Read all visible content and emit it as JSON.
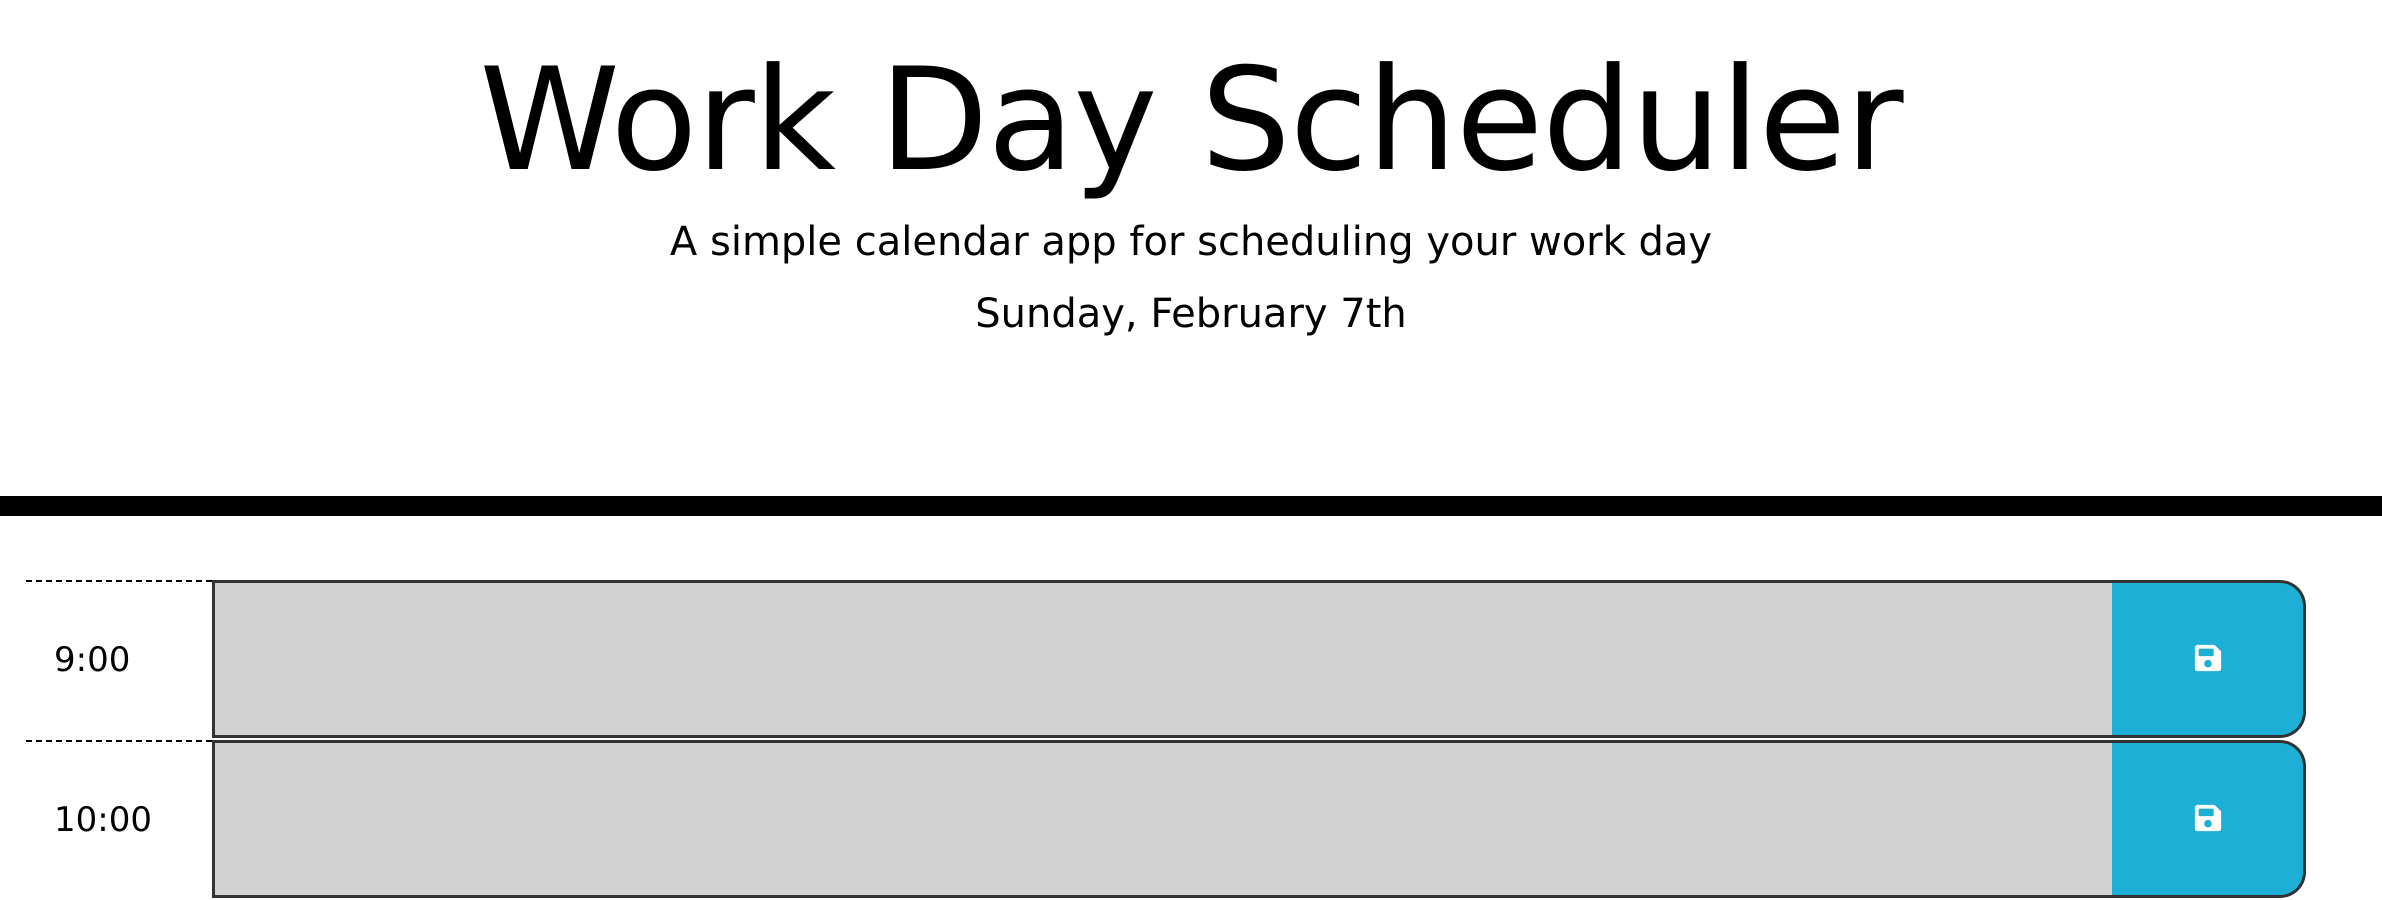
{
  "header": {
    "title": "Work Day Scheduler",
    "lead": "A simple calendar app for scheduling your work day",
    "current_day": "Sunday, February 7th"
  },
  "time_blocks": [
    {
      "hour": "9:00",
      "description": ""
    },
    {
      "hour": "10:00",
      "description": ""
    }
  ],
  "colors": {
    "past": "#d3d3d3",
    "save_button": "#1eafd7",
    "rule": "#000000"
  },
  "icons": {
    "save": "floppy-disk-icon"
  }
}
